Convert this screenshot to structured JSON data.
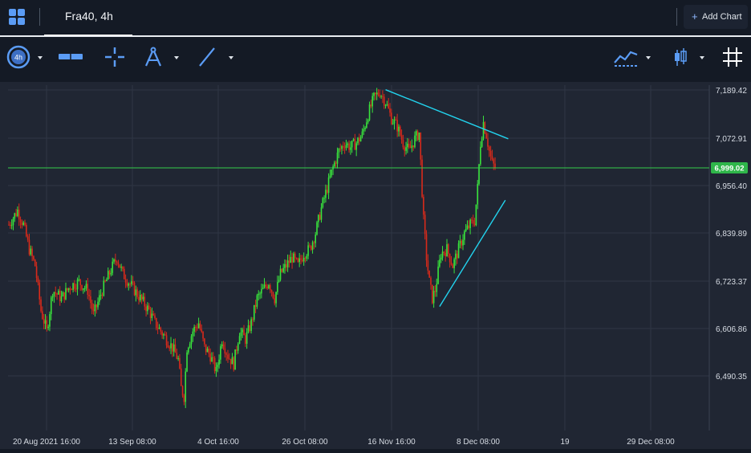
{
  "header": {
    "tab_label": "Fra40, 4h",
    "add_chart_label": "Add Chart",
    "add_chart_plus": "+"
  },
  "toolbar": {
    "interval_badge": "4h"
  },
  "colors": {
    "background": "#202633",
    "up": "#39e33c",
    "down": "#d72a1b",
    "trendline": "#22d3ee",
    "price_line": "#33cc4a",
    "price_badge": "#2fb64a",
    "grid": "#2f3644"
  },
  "chart_data": {
    "type": "candlestick",
    "symbol": "Fra40",
    "timeframe": "4h",
    "y_ticks": [
      "7,189.42",
      "7,072.91",
      "6,956.40",
      "6,839.89",
      "6,723.37",
      "6,606.86",
      "6,490.35"
    ],
    "y_tick_values": [
      7189.42,
      7072.91,
      6956.4,
      6839.89,
      6723.37,
      6606.86,
      6490.35
    ],
    "ylim": [
      6390,
      7220
    ],
    "x_ticks": [
      "20 Aug 2021 16:00",
      "13 Sep 08:00",
      "4 Oct 16:00",
      "26 Oct 08:00",
      "16 Nov 16:00",
      "8 Dec 08:00",
      "19",
      "29 Dec 08:00"
    ],
    "current_price": 6999.02,
    "current_price_label": "6,999.02",
    "grid": true,
    "path_points": [
      [
        0,
        6860
      ],
      [
        6,
        6895
      ],
      [
        10,
        6860
      ],
      [
        14,
        6800
      ],
      [
        18,
        6760
      ],
      [
        22,
        6650
      ],
      [
        26,
        6600
      ],
      [
        30,
        6700
      ],
      [
        36,
        6680
      ],
      [
        42,
        6710
      ],
      [
        48,
        6720
      ],
      [
        54,
        6700
      ],
      [
        58,
        6640
      ],
      [
        64,
        6700
      ],
      [
        70,
        6750
      ],
      [
        74,
        6780
      ],
      [
        78,
        6740
      ],
      [
        84,
        6710
      ],
      [
        90,
        6680
      ],
      [
        96,
        6650
      ],
      [
        100,
        6620
      ],
      [
        104,
        6600
      ],
      [
        108,
        6580
      ],
      [
        112,
        6560
      ],
      [
        116,
        6530
      ],
      [
        118,
        6460
      ],
      [
        120,
        6440
      ],
      [
        122,
        6560
      ],
      [
        126,
        6600
      ],
      [
        130,
        6620
      ],
      [
        134,
        6560
      ],
      [
        138,
        6540
      ],
      [
        142,
        6500
      ],
      [
        146,
        6580
      ],
      [
        150,
        6540
      ],
      [
        154,
        6520
      ],
      [
        158,
        6600
      ],
      [
        162,
        6580
      ],
      [
        166,
        6620
      ],
      [
        170,
        6680
      ],
      [
        174,
        6700
      ],
      [
        178,
        6720
      ],
      [
        182,
        6680
      ],
      [
        186,
        6740
      ],
      [
        190,
        6760
      ],
      [
        194,
        6780
      ],
      [
        198,
        6760
      ],
      [
        202,
        6790
      ],
      [
        206,
        6800
      ],
      [
        210,
        6840
      ],
      [
        214,
        6900
      ],
      [
        218,
        6950
      ],
      [
        222,
        7000
      ],
      [
        226,
        7040
      ],
      [
        230,
        7060
      ],
      [
        234,
        7050
      ],
      [
        238,
        7060
      ],
      [
        242,
        7080
      ],
      [
        246,
        7130
      ],
      [
        250,
        7170
      ],
      [
        254,
        7185
      ],
      [
        258,
        7160
      ],
      [
        262,
        7120
      ],
      [
        266,
        7100
      ],
      [
        270,
        7060
      ],
      [
        274,
        7040
      ],
      [
        278,
        7070
      ],
      [
        281,
        7085
      ],
      [
        284,
        6870
      ],
      [
        286,
        6780
      ],
      [
        288,
        6720
      ],
      [
        290,
        6680
      ],
      [
        292,
        6700
      ],
      [
        296,
        6790
      ],
      [
        300,
        6800
      ],
      [
        304,
        6760
      ],
      [
        308,
        6800
      ],
      [
        312,
        6840
      ],
      [
        316,
        6860
      ],
      [
        319,
        6870
      ],
      [
        321,
        6950
      ],
      [
        323,
        7060
      ],
      [
        325,
        7110
      ],
      [
        327,
        7080
      ],
      [
        329,
        7040
      ],
      [
        331,
        7010
      ],
      [
        333,
        7000
      ]
    ],
    "trendlines": [
      {
        "from": [
          258,
          7190
        ],
        "to": [
          342,
          7070
        ]
      },
      {
        "from": [
          295,
          6660
        ],
        "to": [
          340,
          6920
        ]
      }
    ]
  }
}
